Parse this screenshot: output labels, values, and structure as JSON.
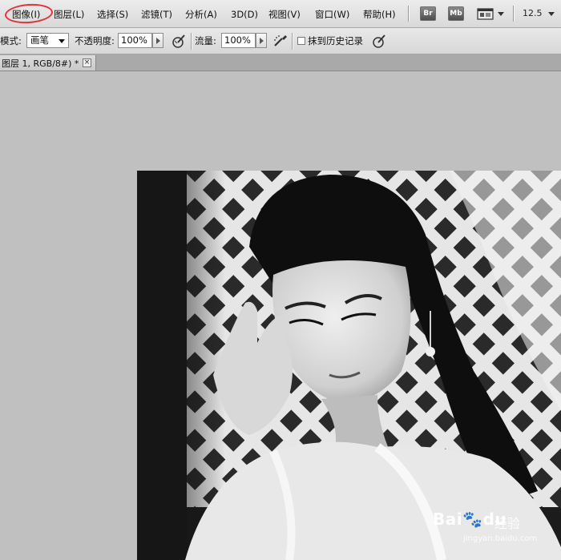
{
  "menubar": {
    "items": [
      "图像(I)",
      "图层(L)",
      "选择(S)",
      "滤镜(T)",
      "分析(A)",
      "3D(D)",
      "视图(V)",
      "窗口(W)",
      "帮助(H)"
    ],
    "bridge_label": "Br",
    "minibridge_label": "Mb",
    "zoom": "12.5"
  },
  "options": {
    "mode_label": "模式:",
    "mode_value": "画笔",
    "opacity_label": "不透明度:",
    "opacity_value": "100%",
    "flow_label": "流量:",
    "flow_value": "100%",
    "history_label": "抹到历史记录"
  },
  "document": {
    "tab_title": "图层 1, RGB/8#) *",
    "close_glyph": "×"
  },
  "watermark": {
    "brand": "Bai",
    "brand_tail": "du",
    "cn": "经验",
    "url": "jingyan.baidu.com"
  },
  "colors": {
    "annotation": "#e0343a",
    "workspace": "#c0c0c0"
  }
}
